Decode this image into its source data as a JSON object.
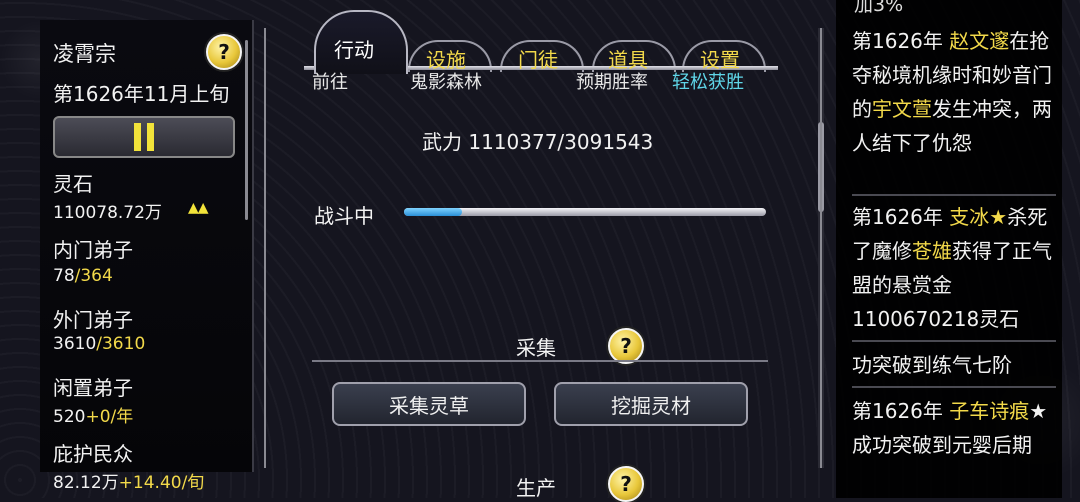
{
  "left": {
    "sect_name": "凌霄宗",
    "date": "第1626年11月上旬",
    "spirit_stone_label": "灵石",
    "spirit_stone_value": "110078.72万",
    "spirit_stone_trend": "▲▲",
    "inner_label": "内门弟子",
    "inner_current": "78",
    "inner_max": "/364",
    "outer_label": "外门弟子",
    "outer_current": "3610",
    "outer_max": "/3610",
    "idle_label": "闲置弟子",
    "idle_current": "520",
    "idle_rate": "+0/年",
    "protect_label": "庇护民众",
    "protect_current": "82.12万",
    "protect_rate": "+14.40/旬"
  },
  "tabs": {
    "action": "行动",
    "facility": "设施",
    "disciples": "门徒",
    "items": "道具",
    "settings": "设置"
  },
  "center": {
    "cutoff_left": "前往",
    "cutoff_mid": "鬼影森林",
    "cutoff_right_a": "预期胜率",
    "cutoff_right_b": "轻松获胜",
    "power_text": "武力 1110377/3091543",
    "battle_label": "战斗中",
    "battle_progress": 0.16,
    "gather_title": "采集",
    "gather_herb": "采集灵草",
    "dig_material": "挖掘灵材",
    "produce_title": "生产"
  },
  "log": {
    "top_cut": "加3%",
    "e1_pre": "第1626年 ",
    "e1_name": "赵文邃",
    "e1_mid": "在抢夺秘境机缘时和妙音门的",
    "e1_name2": "宇文萱",
    "e1_post": "发生冲突，两人结下了仇怨",
    "e2_pre": "第1626年 ",
    "e2_name": "支冰★",
    "e2_mid": "杀死了魔修",
    "e2_name2": "苍雄",
    "e2_post": "获得了正气盟的悬赏金1100670218灵石",
    "e3_text": "功突破到练气七阶",
    "e4_pre": "第1626年 ",
    "e4_name": "子车诗痕",
    "e4_post": "★成功突破到元婴后期"
  },
  "colors": {
    "name_highlight": "#f2d94a",
    "progress_fill": "#2a8fd6",
    "pause_yellow": "#f2e33a"
  }
}
